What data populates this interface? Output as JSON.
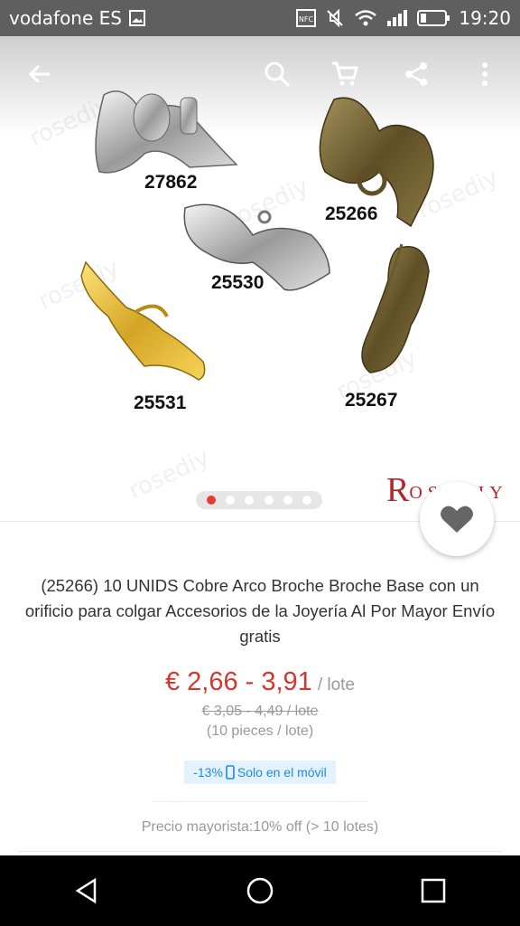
{
  "status_bar": {
    "carrier": "vodafone ES",
    "nfc": "NFC",
    "time": "19:20"
  },
  "toolbar": {
    "icons": [
      "back-arrow-icon",
      "search-icon",
      "cart-icon",
      "share-icon",
      "more-vert-icon"
    ]
  },
  "gallery": {
    "labels": [
      "27862",
      "25266",
      "25530",
      "25531",
      "25267"
    ],
    "watermark": "rosediy",
    "brand": "R",
    "brand_suffix": "OSEDIY",
    "slide_count": 6,
    "active_slide": 1
  },
  "product": {
    "title": "(25266) 10 UNIDS Cobre Arco Broche Broche Base con un orificio para colgar Accesorios de la Joyería Al Por Mayor Envío gratis",
    "price": "€ 2,66 - 3,91",
    "price_unit": "/ lote",
    "old_price": "€ 3,05 - 4,49 / lote",
    "pieces": "(10 pieces / lote)",
    "badge_discount": "-13%",
    "badge_text": "Solo en el móvil",
    "wholesale": "Precio mayorista:10% off (> 10 lotes)"
  },
  "colors": {
    "accent": "#d9362b",
    "badge_bg": "#e3f2fd",
    "badge_text": "#1e88e5"
  }
}
